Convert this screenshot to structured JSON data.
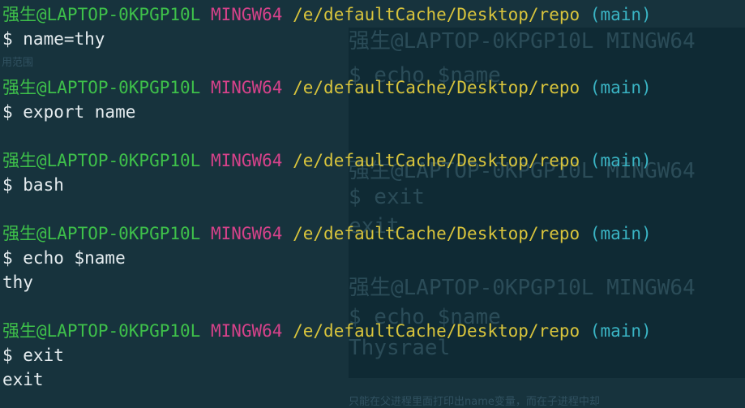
{
  "prompt": {
    "user_host": "强生@LAPTOP-0KPGP10L",
    "shell": "MINGW64",
    "path": "/e/defaultCache/Desktop/repo",
    "branch": "(main)"
  },
  "lines": [
    {
      "type": "prompt"
    },
    {
      "type": "command",
      "text": "$ name=thy"
    },
    {
      "type": "prompt"
    },
    {
      "type": "command",
      "text": "$ export name"
    },
    {
      "type": "prompt"
    },
    {
      "type": "command",
      "text": "$ bash"
    },
    {
      "type": "prompt"
    },
    {
      "type": "command",
      "text": "$ echo $name"
    },
    {
      "type": "output",
      "text": "thy"
    },
    {
      "type": "prompt"
    },
    {
      "type": "command",
      "text": "$ exit"
    },
    {
      "type": "output",
      "text": "exit"
    }
  ],
  "background_window": {
    "small_label": "用范围",
    "lines": [
      "强生@LAPTOP-0KPGP10L MINGW64",
      "$ echo $name",
      "强生@LAPTOP-0KPGP10L MINGW64",
      "$ exit",
      "exit",
      "强生@LAPTOP-0KPGP10L MINGW64",
      "$ echo $name",
      "Thysrael"
    ],
    "footer_text": "只能在父进程里面打印出name变量，而在子进程中却"
  },
  "colors": {
    "background": "#17333d",
    "user_host": "#3ec04a",
    "shell": "#d6428a",
    "path": "#d8c43c",
    "branch": "#3ab4c4",
    "text": "#e6edf0"
  }
}
